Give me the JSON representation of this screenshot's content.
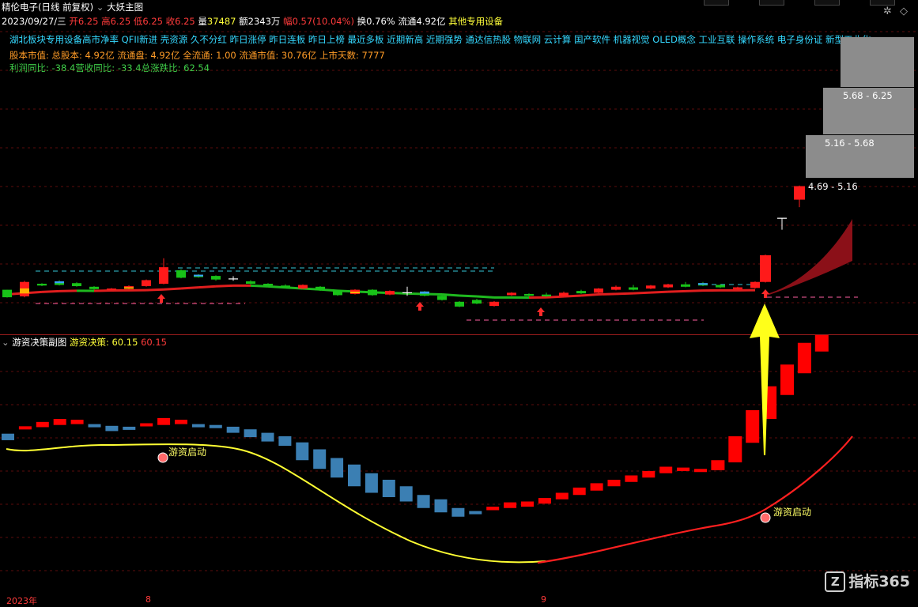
{
  "header": {
    "stock_name": "精伦电子(日线 前复权)",
    "collapse_icon": "chevron-down-icon",
    "indicator_name": "大妖主图"
  },
  "quote": {
    "date": "2023/09/27/三",
    "open_label": "开",
    "open": "6.25",
    "high_label": "高",
    "high": "6.25",
    "low_label": "低",
    "low": "6.25",
    "close_label": "收",
    "close": "6.25",
    "volume_label": "量",
    "volume": "37487",
    "amount_label": "额",
    "amount": "2343万",
    "change_label": "幅",
    "change": "0.57(10.04%)",
    "turnover_label": "换",
    "turnover": "0.76%",
    "float_label": "流通",
    "float": "4.92亿",
    "industry": "其他专用设备"
  },
  "concepts": "湖北板块专用设备高市净率 QFII新进 壳资源 久不分红 昨日涨停 昨日连板 昨日上榜 最近多板 近期新高 近期强势 通达信热股 物联网 云计算 国产软件 机器视觉 OLED概念 工业互联 操作系统 电子身份证 新型工业化",
  "stock_info": "股本市值: 总股本: 4.92亿 流通盘: 4.92亿 全流通: 1.00 流通市值: 30.76亿 上市天数: 7777",
  "profit": {
    "label1": "利润同比:",
    "value1": "-38.4",
    "label2": "营收同比:",
    "value2": "-33.4",
    "label3": "总涨跌比:",
    "value3": "62.54"
  },
  "price_boxes": [
    "5.68 - 6.25",
    "5.16 - 5.68",
    "4.69 - 5.16"
  ],
  "sub_panel": {
    "collapse_icon": "chevron-down-icon",
    "title": "游资决策副图",
    "indicator_label": "游资决策:",
    "indicator_value": "60.15",
    "indicator_value2": "60.15",
    "signal_label": "游资启动"
  },
  "x_axis": {
    "year": "2023年",
    "month1": "8",
    "month2": "9"
  },
  "watermark": {
    "brand": "指标365",
    "icon": "z-logo-icon"
  },
  "colors": {
    "up": "#ff1a1a",
    "down": "#18c218",
    "steel": "#3b7fb3",
    "ma": "#ffff33",
    "background": "#000000"
  },
  "chart_data": {
    "type": "candlestick",
    "main_candles": [
      {
        "o": 0.3,
        "c": 0.05,
        "h": 0.3,
        "l": 0.04,
        "kind": "down"
      },
      {
        "o": 0.08,
        "c": 0.56,
        "h": 0.6,
        "l": 0.05,
        "kind": "up-yellow"
      },
      {
        "o": 0.5,
        "c": 0.44,
        "h": 0.52,
        "l": 0.42,
        "kind": "down"
      },
      {
        "o": 0.58,
        "c": 0.46,
        "h": 0.62,
        "l": 0.44,
        "kind": "down-blue"
      },
      {
        "o": 0.52,
        "c": 0.42,
        "h": 0.55,
        "l": 0.4,
        "kind": "down"
      },
      {
        "o": 0.4,
        "c": 0.32,
        "h": 0.42,
        "l": 0.3,
        "kind": "down"
      },
      {
        "o": 0.3,
        "c": 0.34,
        "h": 0.36,
        "l": 0.28,
        "kind": "up"
      },
      {
        "o": 0.34,
        "c": 0.42,
        "h": 0.45,
        "l": 0.32,
        "kind": "up-yellow"
      },
      {
        "o": 0.42,
        "c": 0.62,
        "h": 0.64,
        "l": 0.4,
        "kind": "up"
      },
      {
        "o": 0.5,
        "c": 1.05,
        "h": 1.35,
        "l": 0.48,
        "kind": "up"
      },
      {
        "o": 0.95,
        "c": 0.7,
        "h": 0.98,
        "l": 0.68,
        "kind": "down"
      },
      {
        "o": 0.8,
        "c": 0.72,
        "h": 0.82,
        "l": 0.7,
        "kind": "down-blue"
      },
      {
        "o": 0.76,
        "c": 0.64,
        "h": 0.78,
        "l": 0.6,
        "kind": "down"
      },
      {
        "o": 0.66,
        "c": 0.62,
        "h": 0.75,
        "l": 0.6,
        "kind": "cross"
      },
      {
        "o": 0.58,
        "c": 0.5,
        "h": 0.62,
        "l": 0.48,
        "kind": "down"
      },
      {
        "o": 0.5,
        "c": 0.44,
        "h": 0.52,
        "l": 0.42,
        "kind": "down"
      },
      {
        "o": 0.44,
        "c": 0.4,
        "h": 0.48,
        "l": 0.38,
        "kind": "down"
      },
      {
        "o": 0.34,
        "c": 0.46,
        "h": 0.48,
        "l": 0.32,
        "kind": "up"
      },
      {
        "o": 0.4,
        "c": 0.28,
        "h": 0.42,
        "l": 0.26,
        "kind": "down"
      },
      {
        "o": 0.28,
        "c": 0.12,
        "h": 0.3,
        "l": 0.1,
        "kind": "down"
      },
      {
        "o": 0.16,
        "c": 0.3,
        "h": 0.32,
        "l": 0.14,
        "kind": "up-yellow"
      },
      {
        "o": 0.3,
        "c": 0.12,
        "h": 0.32,
        "l": 0.1,
        "kind": "down"
      },
      {
        "o": 0.14,
        "c": 0.26,
        "h": 0.28,
        "l": 0.12,
        "kind": "up"
      },
      {
        "o": 0.2,
        "c": 0.16,
        "h": 0.4,
        "l": 0.1,
        "kind": "cross"
      },
      {
        "o": 0.24,
        "c": 0.1,
        "h": 0.26,
        "l": 0.08,
        "kind": "down-blue"
      },
      {
        "o": 0.1,
        "c": -0.04,
        "h": 0.12,
        "l": -0.06,
        "kind": "down"
      },
      {
        "o": -0.1,
        "c": -0.26,
        "h": -0.08,
        "l": -0.28,
        "kind": "down"
      },
      {
        "o": -0.04,
        "c": -0.16,
        "h": 0.0,
        "l": -0.18,
        "kind": "down"
      },
      {
        "o": -0.24,
        "c": -0.1,
        "h": -0.08,
        "l": -0.26,
        "kind": "up"
      },
      {
        "o": 0.12,
        "c": 0.2,
        "h": 0.22,
        "l": 0.1,
        "kind": "up"
      },
      {
        "o": 0.16,
        "c": 0.1,
        "h": 0.18,
        "l": 0.08,
        "kind": "down"
      },
      {
        "o": 0.14,
        "c": 0.08,
        "h": 0.2,
        "l": 0.06,
        "kind": "down"
      },
      {
        "o": 0.1,
        "c": 0.2,
        "h": 0.24,
        "l": 0.08,
        "kind": "up"
      },
      {
        "o": 0.26,
        "c": 0.18,
        "h": 0.3,
        "l": 0.16,
        "kind": "down"
      },
      {
        "o": 0.2,
        "c": 0.34,
        "h": 0.36,
        "l": 0.18,
        "kind": "up"
      },
      {
        "o": 0.3,
        "c": 0.4,
        "h": 0.44,
        "l": 0.28,
        "kind": "up"
      },
      {
        "o": 0.38,
        "c": 0.3,
        "h": 0.46,
        "l": 0.28,
        "kind": "down"
      },
      {
        "o": 0.34,
        "c": 0.44,
        "h": 0.46,
        "l": 0.32,
        "kind": "up"
      },
      {
        "o": 0.38,
        "c": 0.48,
        "h": 0.5,
        "l": 0.36,
        "kind": "up"
      },
      {
        "o": 0.48,
        "c": 0.4,
        "h": 0.56,
        "l": 0.38,
        "kind": "down"
      },
      {
        "o": 0.44,
        "c": 0.52,
        "h": 0.56,
        "l": 0.42,
        "kind": "down-blue"
      },
      {
        "o": 0.46,
        "c": 0.38,
        "h": 0.48,
        "l": 0.36,
        "kind": "down"
      },
      {
        "o": 0.32,
        "c": 0.38,
        "h": 0.4,
        "l": 0.3,
        "kind": "up"
      },
      {
        "o": 0.36,
        "c": 0.56,
        "h": 0.58,
        "l": 0.34,
        "kind": "up"
      },
      {
        "o": 0.56,
        "c": 1.45,
        "h": 1.47,
        "l": 0.54,
        "kind": "up"
      },
      {
        "o": 2.65,
        "c": 2.68,
        "h": 2.68,
        "l": 2.3,
        "kind": "cross"
      },
      {
        "o": 3.3,
        "c": 3.75,
        "h": 3.77,
        "l": 3.05,
        "kind": "up"
      }
    ],
    "sub_bars": [
      {
        "o": 0.46,
        "c": 0.31,
        "kind": "steel"
      },
      {
        "o": 0.57,
        "c": 0.63,
        "kind": "red"
      },
      {
        "o": 0.61,
        "c": 0.73,
        "kind": "red"
      },
      {
        "o": 0.66,
        "c": 0.8,
        "kind": "red"
      },
      {
        "o": 0.68,
        "c": 0.78,
        "kind": "red"
      },
      {
        "o": 0.68,
        "c": 0.64,
        "kind": "steel"
      },
      {
        "o": 0.64,
        "c": 0.52,
        "kind": "steel"
      },
      {
        "o": 0.62,
        "c": 0.55,
        "kind": "steel"
      },
      {
        "o": 0.64,
        "c": 0.7,
        "kind": "red"
      },
      {
        "o": 0.66,
        "c": 0.82,
        "kind": "red"
      },
      {
        "o": 0.68,
        "c": 0.78,
        "kind": "red"
      },
      {
        "o": 0.68,
        "c": 0.64,
        "kind": "steel"
      },
      {
        "o": 0.66,
        "c": 0.6,
        "kind": "steel"
      },
      {
        "o": 0.62,
        "c": 0.48,
        "kind": "steel"
      },
      {
        "o": 0.56,
        "c": 0.38,
        "kind": "steel"
      },
      {
        "o": 0.48,
        "c": 0.28,
        "kind": "steel"
      },
      {
        "o": 0.4,
        "c": 0.18,
        "kind": "steel"
      },
      {
        "o": 0.26,
        "c": -0.15,
        "kind": "steel"
      },
      {
        "o": 0.1,
        "c": -0.35,
        "kind": "steel"
      },
      {
        "o": -0.1,
        "c": -0.55,
        "kind": "steel"
      },
      {
        "o": -0.25,
        "c": -0.75,
        "kind": "steel"
      },
      {
        "o": -0.45,
        "c": -0.9,
        "kind": "steel"
      },
      {
        "o": -0.6,
        "c": -1.0,
        "kind": "steel"
      },
      {
        "o": -0.75,
        "c": -1.1,
        "kind": "steel"
      },
      {
        "o": -0.95,
        "c": -1.25,
        "kind": "steel"
      },
      {
        "o": -1.05,
        "c": -1.35,
        "kind": "steel"
      },
      {
        "o": -1.25,
        "c": -1.45,
        "kind": "steel"
      },
      {
        "o": -1.32,
        "c": -1.38,
        "kind": "steel"
      },
      {
        "o": -1.3,
        "c": -1.22,
        "kind": "red"
      },
      {
        "o": -1.25,
        "c": -1.12,
        "kind": "red"
      },
      {
        "o": -1.22,
        "c": -1.1,
        "kind": "red"
      },
      {
        "o": -1.15,
        "c": -1.02,
        "kind": "red"
      },
      {
        "o": -1.05,
        "c": -0.9,
        "kind": "red"
      },
      {
        "o": -0.95,
        "c": -0.78,
        "kind": "red"
      },
      {
        "o": -0.85,
        "c": -0.68,
        "kind": "red"
      },
      {
        "o": -0.75,
        "c": -0.6,
        "kind": "red"
      },
      {
        "o": -0.65,
        "c": -0.5,
        "kind": "red"
      },
      {
        "o": -0.55,
        "c": -0.4,
        "kind": "red"
      },
      {
        "o": -0.45,
        "c": -0.3,
        "kind": "red"
      },
      {
        "o": -0.4,
        "c": -0.32,
        "kind": "red"
      },
      {
        "o": -0.4,
        "c": -0.35,
        "kind": "red"
      },
      {
        "o": -0.38,
        "c": -0.15,
        "kind": "red"
      },
      {
        "o": -0.2,
        "c": 0.4,
        "kind": "red"
      },
      {
        "o": 0.25,
        "c": 1.0,
        "kind": "red"
      },
      {
        "o": 0.8,
        "c": 1.55,
        "kind": "red"
      },
      {
        "o": 1.35,
        "c": 2.05,
        "kind": "red"
      },
      {
        "o": 1.85,
        "c": 2.55,
        "kind": "red"
      },
      {
        "o": 2.35,
        "c": 3.0,
        "kind": "red"
      },
      {
        "o": 2.8,
        "c": 3.4,
        "kind": "red"
      }
    ]
  }
}
